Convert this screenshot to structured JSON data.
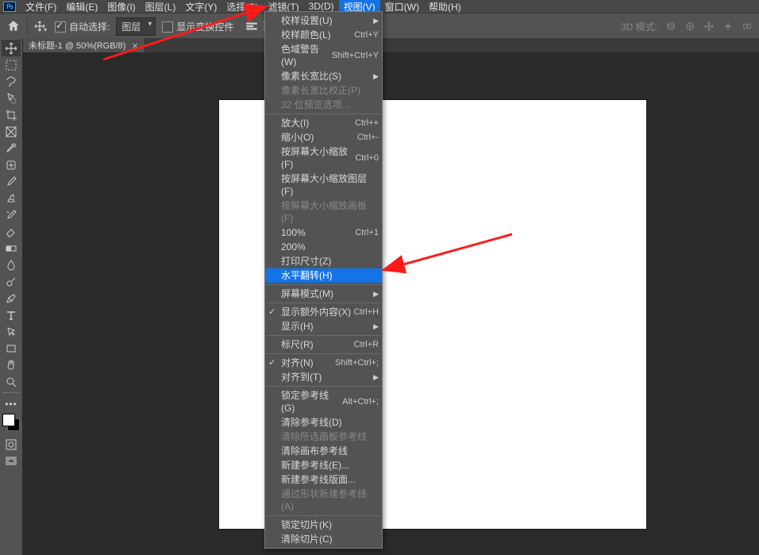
{
  "menubar": {
    "items": [
      "文件(F)",
      "编辑(E)",
      "图像(I)",
      "图层(L)",
      "文字(Y)",
      "选择(S)",
      "滤镜(T)",
      "3D(D)",
      "视图(V)",
      "窗口(W)",
      "帮助(H)"
    ]
  },
  "optionbar": {
    "auto_select_label": "自动选择:",
    "layer_select_label": "图层",
    "transform_label": "显示变换控件",
    "mode3d_label": "3D 模式:"
  },
  "doc_tab": {
    "title": "未标题-1 @ 50%(RGB/8)",
    "close": "×"
  },
  "dropdown": {
    "sections": [
      [
        {
          "label": "校样设置(U)",
          "arrow": true
        },
        {
          "label": "校样颜色(L)",
          "shortcut": "Ctrl+Y"
        },
        {
          "label": "色域警告(W)",
          "shortcut": "Shift+Ctrl+Y"
        },
        {
          "label": "像素长宽比(S)",
          "arrow": true
        },
        {
          "label": "像素长宽比校正(P)",
          "disabled": true
        },
        {
          "label": "32 位预览选项...",
          "disabled": true
        }
      ],
      [
        {
          "label": "放大(I)",
          "shortcut": "Ctrl++"
        },
        {
          "label": "缩小(O)",
          "shortcut": "Ctrl+-"
        },
        {
          "label": "按屏幕大小缩放(F)",
          "shortcut": "Ctrl+0"
        },
        {
          "label": "按屏幕大小缩放图层(F)"
        },
        {
          "label": "按屏幕大小缩放画板(F)",
          "disabled": true
        },
        {
          "label": "100%",
          "shortcut": "Ctrl+1"
        },
        {
          "label": "200%"
        },
        {
          "label": "打印尺寸(Z)"
        },
        {
          "label": "水平翻转(H)",
          "highlight": true
        }
      ],
      [
        {
          "label": "屏幕模式(M)",
          "arrow": true
        }
      ],
      [
        {
          "label": "显示额外内容(X)",
          "shortcut": "Ctrl+H",
          "checked": true
        },
        {
          "label": "显示(H)",
          "arrow": true
        }
      ],
      [
        {
          "label": "标尺(R)",
          "shortcut": "Ctrl+R"
        }
      ],
      [
        {
          "label": "对齐(N)",
          "shortcut": "Shift+Ctrl+;",
          "checked": true
        },
        {
          "label": "对齐到(T)",
          "arrow": true
        }
      ],
      [
        {
          "label": "锁定参考线(G)",
          "shortcut": "Alt+Ctrl+;"
        },
        {
          "label": "清除参考线(D)"
        },
        {
          "label": "清除所选画板参考线",
          "disabled": true
        },
        {
          "label": "清除画布参考线"
        },
        {
          "label": "新建参考线(E)..."
        },
        {
          "label": "新建参考线版面..."
        },
        {
          "label": "通过形状新建参考线(A)",
          "disabled": true
        }
      ],
      [
        {
          "label": "锁定切片(K)"
        },
        {
          "label": "清除切片(C)"
        }
      ]
    ]
  },
  "tools": [
    "move-tool",
    "marquee-tool",
    "lasso-tool",
    "quick-select-tool",
    "crop-tool",
    "frame-tool",
    "eyedropper-tool",
    "healing-brush-tool",
    "brush-tool",
    "clone-stamp-tool",
    "history-brush-tool",
    "eraser-tool",
    "gradient-tool",
    "blur-tool",
    "dodge-tool",
    "pen-tool",
    "type-tool",
    "path-select-tool",
    "rectangle-tool",
    "hand-tool",
    "zoom-tool"
  ]
}
